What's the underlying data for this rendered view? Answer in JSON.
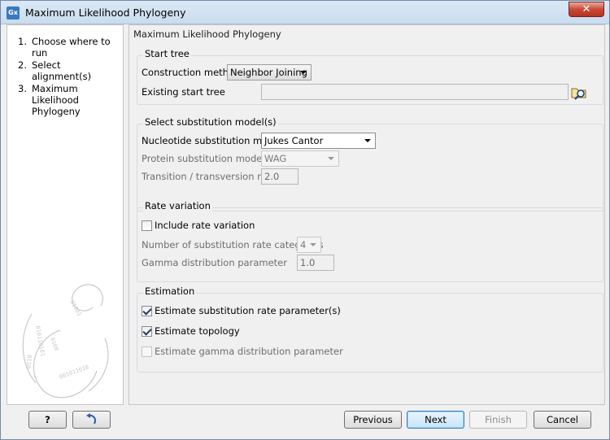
{
  "window": {
    "title": "Maximum Likelihood Phylogeny",
    "app_icon": "Gx",
    "close_label": "✕"
  },
  "steps": [
    {
      "num": "1.",
      "label": "Choose where to run"
    },
    {
      "num": "2.",
      "label": "Select alignment(s)"
    },
    {
      "num": "3.",
      "label": "Maximum Likelihood Phylogeny"
    }
  ],
  "panel_title": "Maximum Likelihood Phylogeny",
  "start_tree": {
    "title": "Start tree",
    "construction_label": "Construction method",
    "construction_value": "Neighbor Joining",
    "existing_label": "Existing start tree",
    "existing_value": ""
  },
  "model": {
    "title": "Select substitution model(s)",
    "nucleotide_label": "Nucleotide substitution model",
    "nucleotide_value": "Jukes Cantor",
    "protein_label": "Protein substitution model",
    "protein_value": "WAG",
    "ratio_label": "Transition / transversion ratio",
    "ratio_value": "2.0"
  },
  "rate": {
    "title": "Rate variation",
    "include_label": "Include rate variation",
    "include_checked": false,
    "categories_label": "Number of substitution rate categories",
    "categories_value": "4",
    "gamma_label": "Gamma distribution parameter",
    "gamma_value": "1.0"
  },
  "estimation": {
    "title": "Estimation",
    "rate_param_label": "Estimate substitution rate parameter(s)",
    "rate_param_checked": true,
    "topology_label": "Estimate topology",
    "topology_checked": true,
    "gamma_label": "Estimate gamma distribution parameter",
    "gamma_checked": false
  },
  "buttons": {
    "help": "?",
    "previous": "Previous",
    "next": "Next",
    "finish": "Finish",
    "cancel": "Cancel"
  }
}
